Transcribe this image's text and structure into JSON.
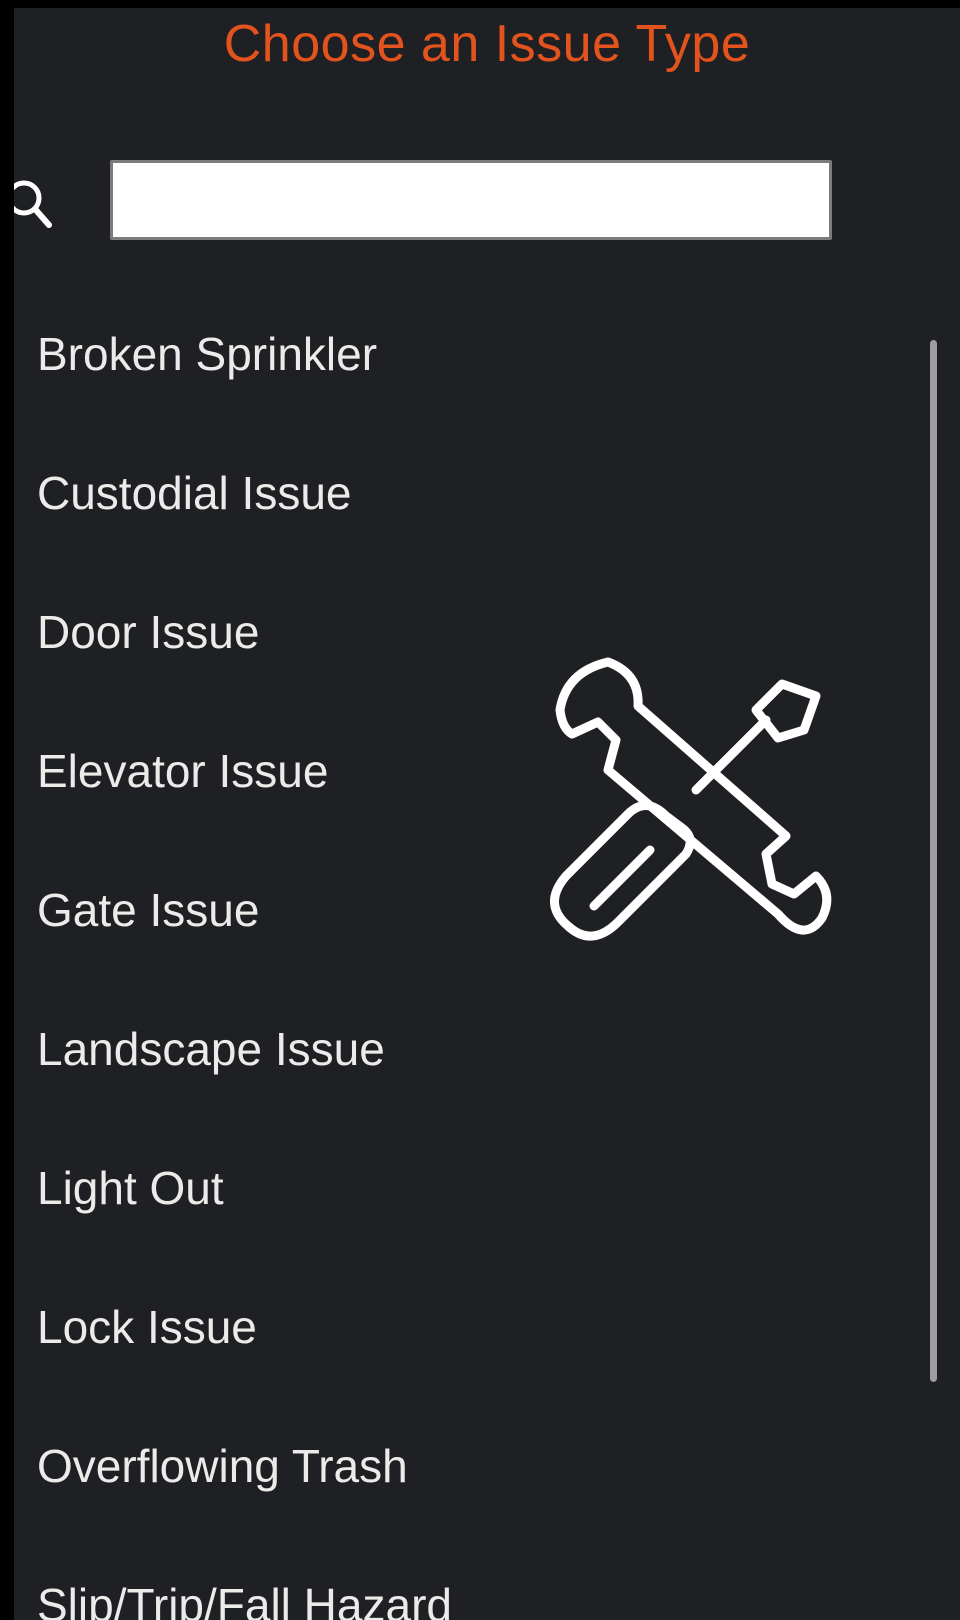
{
  "header": {
    "title": "Choose an Issue Type"
  },
  "search": {
    "icon": "search-icon",
    "value": "",
    "placeholder": ""
  },
  "issue_types": [
    "Broken Sprinkler",
    "Custodial Issue",
    "Door Issue",
    "Elevator Issue",
    "Gate Issue",
    "Landscape Issue",
    "Light Out",
    "Lock Issue",
    "Overflowing Trash",
    "Slip/Trip/Fall Hazard"
  ],
  "decorations": {
    "center_icon": "wrench-screwdriver-icon"
  },
  "colors": {
    "background": "#1f2023",
    "title": "#e2531d",
    "item_text": "#ecebe9",
    "scrollbar": "#9d9d9d"
  }
}
